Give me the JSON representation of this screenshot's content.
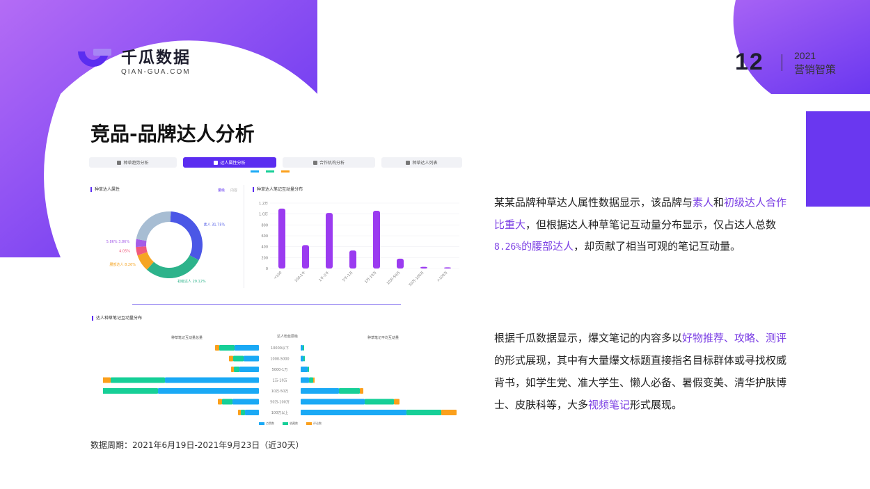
{
  "brand": {
    "name_cn": "千瓜数据",
    "name_en": "QIAN-GUA.COM"
  },
  "header": {
    "page_number": "12",
    "year": "2021",
    "subtitle": "营销智策"
  },
  "title": "竞品-品牌达人分析",
  "dashboard": {
    "tabs": [
      {
        "label": "种草趋势分析",
        "icon": "heart-icon"
      },
      {
        "label": "达人属性分析",
        "icon": "doc-icon"
      },
      {
        "label": "合作机构分析",
        "icon": "building-icon"
      },
      {
        "label": "种草达人列表",
        "icon": "user-icon"
      }
    ],
    "left_panel_title": "种草达人属性",
    "left_panel_links": [
      "量级",
      "内容"
    ],
    "right_panel_title": "种草达人笔记互动量分布",
    "bottom_panel_title": "达人种草笔记互动量分布",
    "bottom_headers": {
      "left": "种草笔记互动量总量",
      "center": "达人粉丝层级",
      "right": "种草笔记平均互动量"
    },
    "legend": [
      "点赞数",
      "收藏数",
      "评论数"
    ]
  },
  "chart_data": [
    {
      "type": "pie",
      "title": "种草达人属性",
      "slices": [
        {
          "name": "素人",
          "label": "素人 31.75%",
          "value": 31.75,
          "color": "#4b57e6"
        },
        {
          "name": "初级达人",
          "label": "初级达人 29.12%",
          "value": 29.12,
          "color": "#2db38b"
        },
        {
          "name": "腰部达人",
          "label": "腰部达人 8.26%",
          "value": 8.26,
          "color": "#f5a524"
        },
        {
          "name": "",
          "label": "4.05%",
          "value": 4.05,
          "color": "#f05a7e"
        },
        {
          "name": "",
          "label": "5.86% 3.86%",
          "value": 3.86,
          "color": "#a45de8"
        },
        {
          "name": "",
          "label": "",
          "value": 23.0,
          "color": "#a7bdd3"
        }
      ]
    },
    {
      "type": "bar",
      "title": "种草达人笔记互动量分布",
      "categories": [
        "<100",
        "100-1千",
        "1千-5千",
        "5千-1万",
        "1万-10万",
        "10万-50万",
        "50万-100万",
        ">100万"
      ],
      "values": [
        1.1,
        0.43,
        1.02,
        0.33,
        1.06,
        0.18,
        0.03,
        0.02
      ],
      "yticks": [
        "0",
        "200",
        "400",
        "600",
        "800",
        "1.0万",
        "1.2万"
      ],
      "ylim": [
        0,
        1.2
      ],
      "color": "#9b3bf0"
    },
    {
      "type": "bar",
      "orientation": "horizontal",
      "categories": [
        "10000以下",
        "1000-5000",
        "5000-1万",
        "1万-10万",
        "10万-50万",
        "50万-100万",
        "100万以上"
      ],
      "series": [
        {
          "name": "点赞数",
          "color": "#1aa9f5",
          "left": [
            35,
            22,
            28,
            135,
            145,
            38,
            20
          ],
          "right": [
            3,
            4,
            10,
            12,
            55,
            92,
            152
          ]
        },
        {
          "name": "收藏数",
          "color": "#16cf97",
          "left": [
            22,
            15,
            8,
            78,
            80,
            15,
            6
          ],
          "right": [
            2,
            2,
            2,
            6,
            30,
            42,
            50
          ]
        },
        {
          "name": "评论数",
          "color": "#fba01c",
          "left": [
            6,
            6,
            4,
            18,
            13,
            6,
            4
          ],
          "right": [
            0,
            0,
            0,
            2,
            5,
            8,
            22
          ]
        }
      ]
    }
  ],
  "period": "数据周期：2021年6月19日-2021年9月23日（近30天）",
  "para1": {
    "a": "某某品牌种草达人属性数据显示，该品牌与",
    "hl1": "素人",
    "b": "和",
    "hl2": "初级达人合作比重大",
    "c": "，但根据达人种草笔记互动量分布显示，仅占达人总数",
    "hl3": "8.26%",
    "hl4": "的腰部达人",
    "d": "，却贡献了相当可观的笔记互动量。"
  },
  "para2": {
    "a": "根据千瓜数据显示，爆文笔记的内容多以",
    "hl1": "好物推荐、攻略、测评",
    "b": "的形式展现，其中有大量爆文标题直接指名目标群体或寻找权威背书，如学生党、准大学生、懒人必备、暑假变美、清华护肤博士、皮肤科等，大多",
    "hl2": "视频笔记",
    "c": "形式展现。"
  }
}
